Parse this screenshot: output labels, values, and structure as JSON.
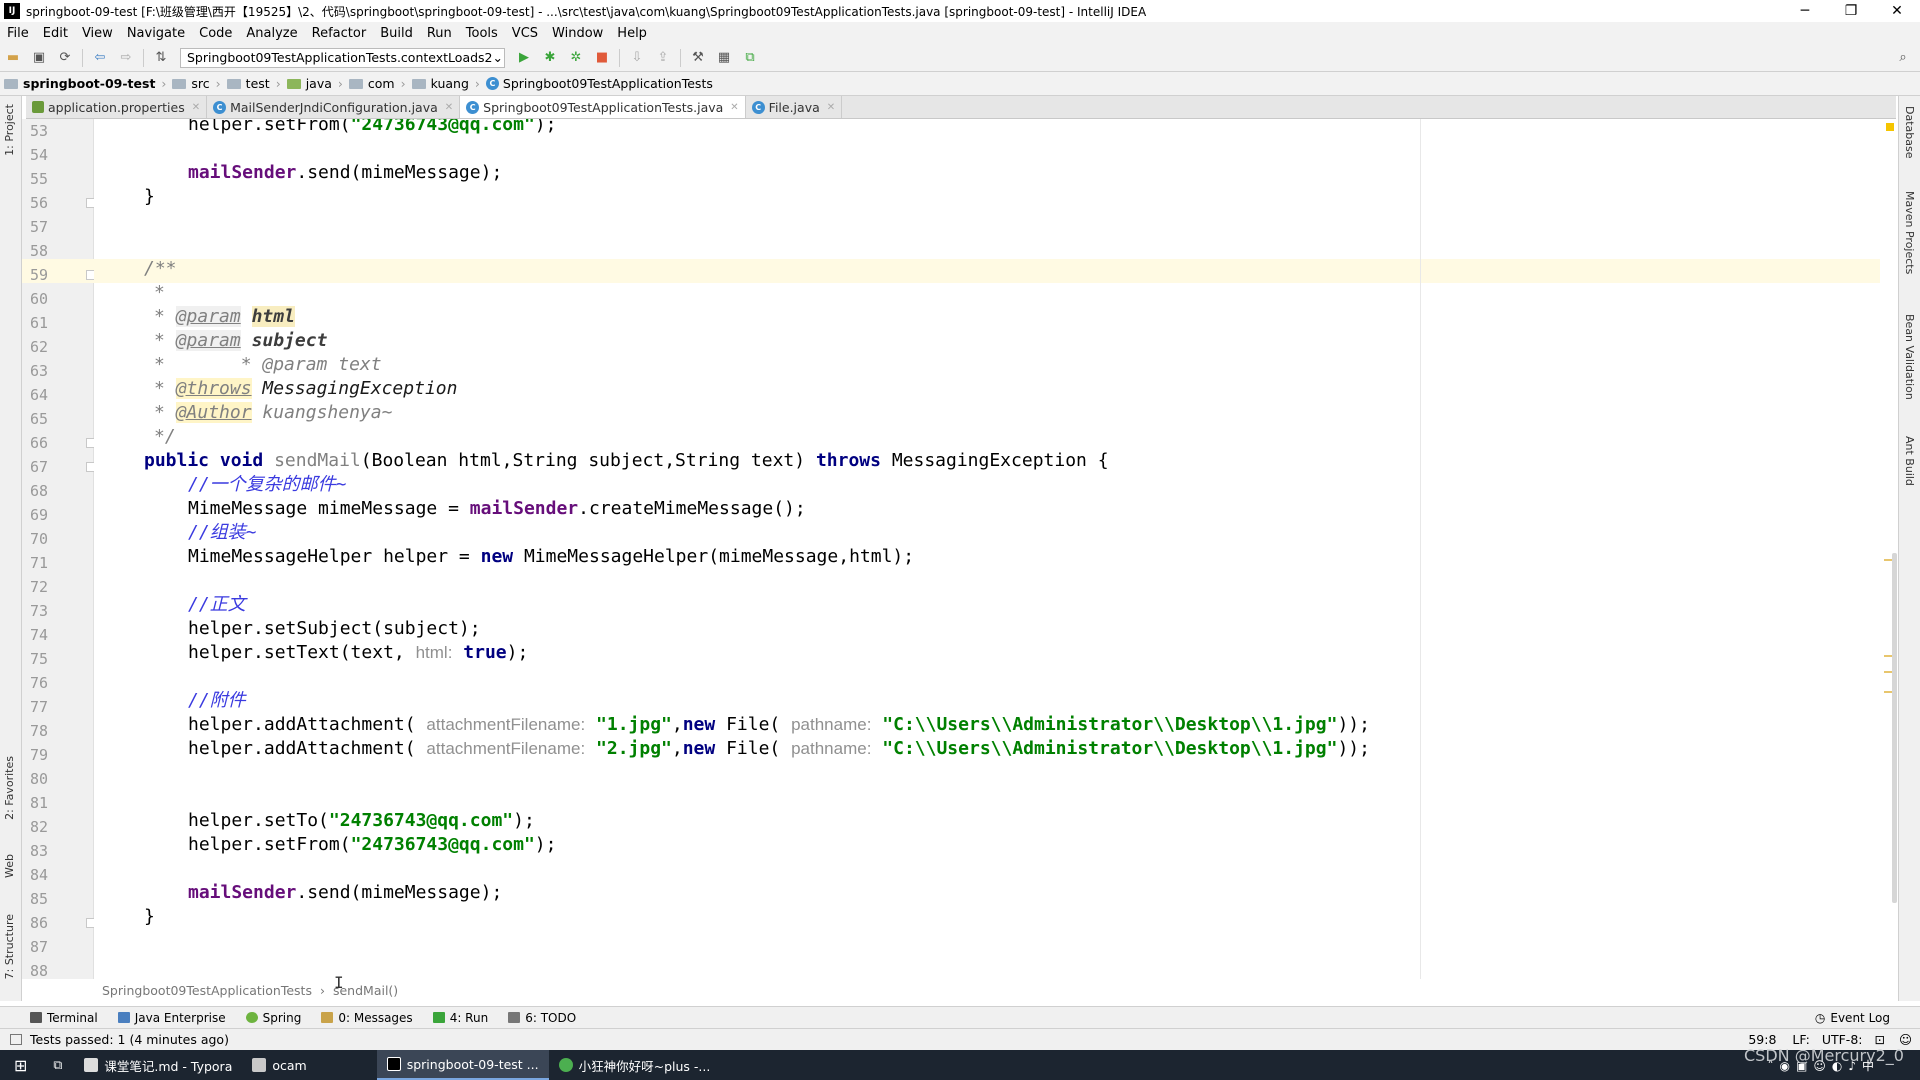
{
  "window": {
    "title": "springboot-09-test [F:\\班级管理\\西开【19525】\\2、代码\\springboot\\springboot-09-test] - ...\\src\\test\\java\\com\\kuang\\Springboot09TestApplicationTests.java [springboot-09-test] - IntelliJ IDEA",
    "minimize": "─",
    "maximize": "❐",
    "close": "✕"
  },
  "menu": [
    "File",
    "Edit",
    "View",
    "Navigate",
    "Code",
    "Analyze",
    "Refactor",
    "Build",
    "Run",
    "Tools",
    "VCS",
    "Window",
    "Help"
  ],
  "toolbar": {
    "run_config": "Springboot09TestApplicationTests.contextLoads2"
  },
  "breadcrumbs": [
    "springboot-09-test",
    "src",
    "test",
    "java",
    "com",
    "kuang",
    "Springboot09TestApplicationTests"
  ],
  "tabs": [
    {
      "label": "application.properties"
    },
    {
      "label": "MailSenderJndiConfiguration.java"
    },
    {
      "label": "Springboot09TestApplicationTests.java"
    },
    {
      "label": "File.java"
    }
  ],
  "left_tools": [
    "1: Project",
    "2: Favorites",
    "Web",
    "7: Structure"
  ],
  "right_tools": [
    "Database",
    "Maven Projects",
    "Bean Validation",
    "Ant Build"
  ],
  "code": {
    "line_numbers": [
      "53",
      "54",
      "55",
      "56",
      "57",
      "58",
      "59",
      "60",
      "61",
      "62",
      "63",
      "64",
      "65",
      "66",
      "67",
      "68",
      "69",
      "70",
      "71",
      "72",
      "73",
      "74",
      "75",
      "76",
      "77",
      "78",
      "79",
      "80",
      "81",
      "82",
      "83",
      "84",
      "85",
      "86",
      "87",
      "88"
    ],
    "l53_a": "helper.setFrom(",
    "l53_s": "\"24736743@qq.com\"",
    "l53_b": ");",
    "l55_f": "mailSender",
    "l55_b": ".send(mimeMessage);",
    "l56": "}",
    "l59": "/**",
    "l60": "*",
    "l61_star": "*",
    "l61_tag": "@param",
    "l61_val": "html",
    "l62_star": "*",
    "l62_tag": "@param",
    "l62_val": "subject",
    "l63": "*       * @param text",
    "l64_star": "*",
    "l64_tag": "@throws",
    "l64_val": "MessagingException",
    "l65_star": "*",
    "l65_tag": "@Author",
    "l65_val": "kuangshenya~",
    "l66": "*/",
    "l67_kw1": "public void",
    "l67_m": "sendMail",
    "l67_a": "(Boolean html,String subject,String text)",
    "l67_kw2": "throws",
    "l67_b": "MessagingException {",
    "l68": "//一个复杂的邮件~",
    "l69_a": "MimeMessage mimeMessage = ",
    "l69_f": "mailSender",
    "l69_b": ".createMimeMessage();",
    "l70": "//组装~",
    "l71_a": "MimeMessageHelper helper = ",
    "l71_kw": "new",
    "l71_b": " MimeMessageHelper(mimeMessage,html);",
    "l73": "//正文",
    "l74": "helper.setSubject(subject);",
    "l75_a": "helper.setText(text, ",
    "l75_h": "html:",
    "l75_kw": "true",
    "l75_b": ");",
    "l77": "//附件",
    "l78_a": "helper.addAttachment( ",
    "l78_h1": "attachmentFilename:",
    "l78_s1": "\"1.jpg\"",
    "l78_c": ",",
    "l78_kw": "new",
    "l78_d": " File( ",
    "l78_h2": "pathname:",
    "l78_s2": "\"C:\\\\Users\\\\Administrator\\\\Desktop\\\\1.jpg\"",
    "l78_e": "));",
    "l79_a": "helper.addAttachment( ",
    "l79_h1": "attachmentFilename:",
    "l79_s1": "\"2.jpg\"",
    "l79_c": ",",
    "l79_kw": "new",
    "l79_d": " File( ",
    "l79_h2": "pathname:",
    "l79_s2": "\"C:\\\\Users\\\\Administrator\\\\Desktop\\\\1.jpg\"",
    "l79_e": "));",
    "l82_a": "helper.setTo(",
    "l82_s": "\"24736743@qq.com\"",
    "l82_b": ");",
    "l83_a": "helper.setFrom(",
    "l83_s": "\"24736743@qq.com\"",
    "l83_b": ");",
    "l85_f": "mailSender",
    "l85_b": ".send(mimeMessage);",
    "l86": "}"
  },
  "editor_breadcrumb": {
    "class": "Springboot09TestApplicationTests",
    "method": "sendMail()"
  },
  "tool_windows": [
    "Terminal",
    "Java Enterprise",
    "Spring",
    "0: Messages",
    "4: Run",
    "6: TODO"
  ],
  "event_log": "Event Log",
  "status": {
    "message": "Tests passed: 1 (4 minutes ago)",
    "position": "59:8",
    "line_sep": "LF:",
    "encoding": "UTF-8:"
  },
  "taskbar": {
    "items": [
      "课堂笔记.md - Typora",
      "ocam",
      "springboot-09-test ...",
      "小狂神你好呀~plus -..."
    ]
  },
  "watermark": "CSDN @Mercury2_0"
}
